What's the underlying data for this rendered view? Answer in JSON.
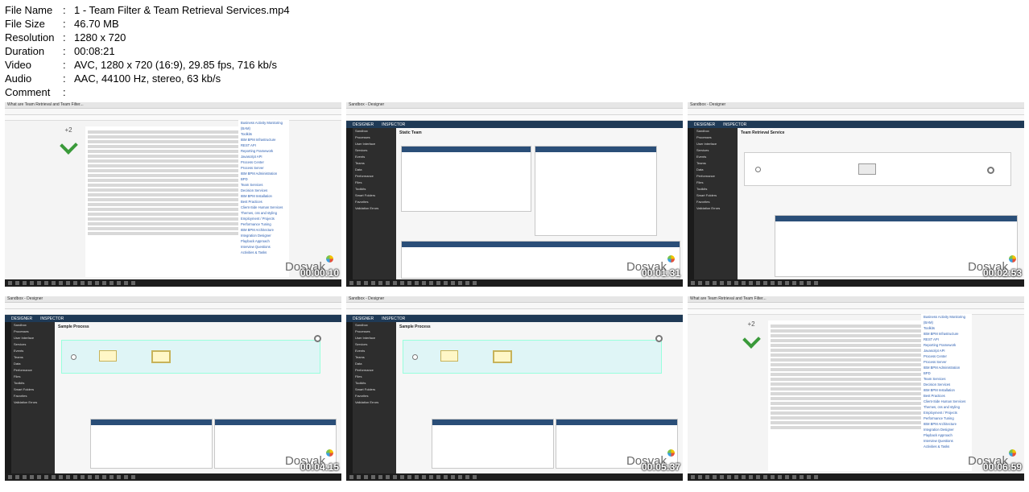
{
  "meta": {
    "rows": [
      {
        "key": "File Name",
        "value": "1 - Team Filter & Team Retrieval Services.mp4"
      },
      {
        "key": "File Size",
        "value": "46.70 MB"
      },
      {
        "key": "Resolution",
        "value": "1280 x 720"
      },
      {
        "key": "Duration",
        "value": "00:08:21"
      },
      {
        "key": "Video",
        "value": "AVC, 1280 x 720 (16:9), 29.85 fps, 716 kb/s"
      },
      {
        "key": "Audio",
        "value": "AAC, 44100 Hz, stereo, 63 kb/s"
      },
      {
        "key": "Comment",
        "value": ""
      }
    ]
  },
  "watermark": "Dosvak",
  "thumbnails": [
    {
      "timestamp": "00:00:10",
      "kind": "web",
      "window_title": "What are Team Retrieval and Team Filter...",
      "app_title": ""
    },
    {
      "timestamp": "00:01:31",
      "kind": "designer",
      "window_title": "Sandbox - Designer",
      "app_title": "Static Team"
    },
    {
      "timestamp": "00:02:53",
      "kind": "designer",
      "window_title": "Sandbox - Designer",
      "app_title": "Team Retrieval Service"
    },
    {
      "timestamp": "00:04:15",
      "kind": "designer",
      "window_title": "Sandbox - Designer",
      "app_title": "Sample Process"
    },
    {
      "timestamp": "00:05:37",
      "kind": "designer",
      "window_title": "Sandbox - Designer",
      "app_title": "Sample Process"
    },
    {
      "timestamp": "00:06:59",
      "kind": "web",
      "window_title": "What are Team Retrieval and Team Filter...",
      "app_title": ""
    }
  ],
  "designer": {
    "tabs": [
      "DESIGNER",
      "INSPECTOR"
    ],
    "nav_items": [
      "Sandbox",
      "Processes",
      "User Interface",
      "Services",
      "Events",
      "Teams",
      "Data",
      "Performance",
      "Files",
      "Toolkits",
      "Smart Folders",
      "Favorites",
      "Validation Errors"
    ]
  },
  "web": {
    "vote_count": "+2",
    "sidebar_links": [
      "Business Activity Monitoring (BAM)",
      "Toolkits",
      "IBM BPM Infrastructure",
      "REST API",
      "Reporting Framework",
      "Javascript API",
      "Process Center",
      "Process Server",
      "IBM BPM Administration",
      "BPD",
      "Team Services",
      "Decision Services",
      "IBM BPM Installation",
      "Best Practices",
      "Client-Side Human Services",
      "Themes, css and styling",
      "Employment / Projects",
      "Performance Tuning",
      "IBM BPM Architecture",
      "Integration Designer",
      "Playback Approach",
      "Interview Questions",
      "Activities & Tasks"
    ]
  }
}
